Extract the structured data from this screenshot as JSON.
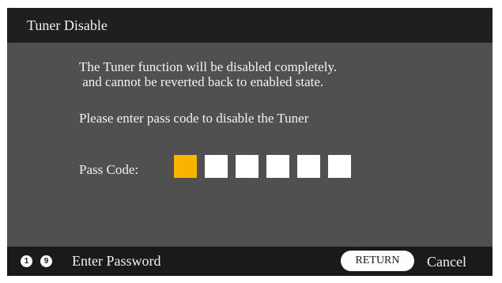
{
  "dialog": {
    "title": "Tuner Disable",
    "message_line1": "The Tuner function will be disabled completely.",
    "message_line2": " and cannot be reverted back to enabled state.",
    "instruction": "Please enter pass code to disable the Tuner",
    "passcode_label": "Pass Code:",
    "passcode": {
      "length": 6,
      "active_index": 0,
      "colors": {
        "active": "#f9b400",
        "inactive": "#ffffff"
      }
    }
  },
  "footer": {
    "key_first": "1",
    "key_last": "9",
    "enter_password_label": "Enter Password",
    "return_label": "RETURN",
    "cancel_label": "Cancel"
  }
}
